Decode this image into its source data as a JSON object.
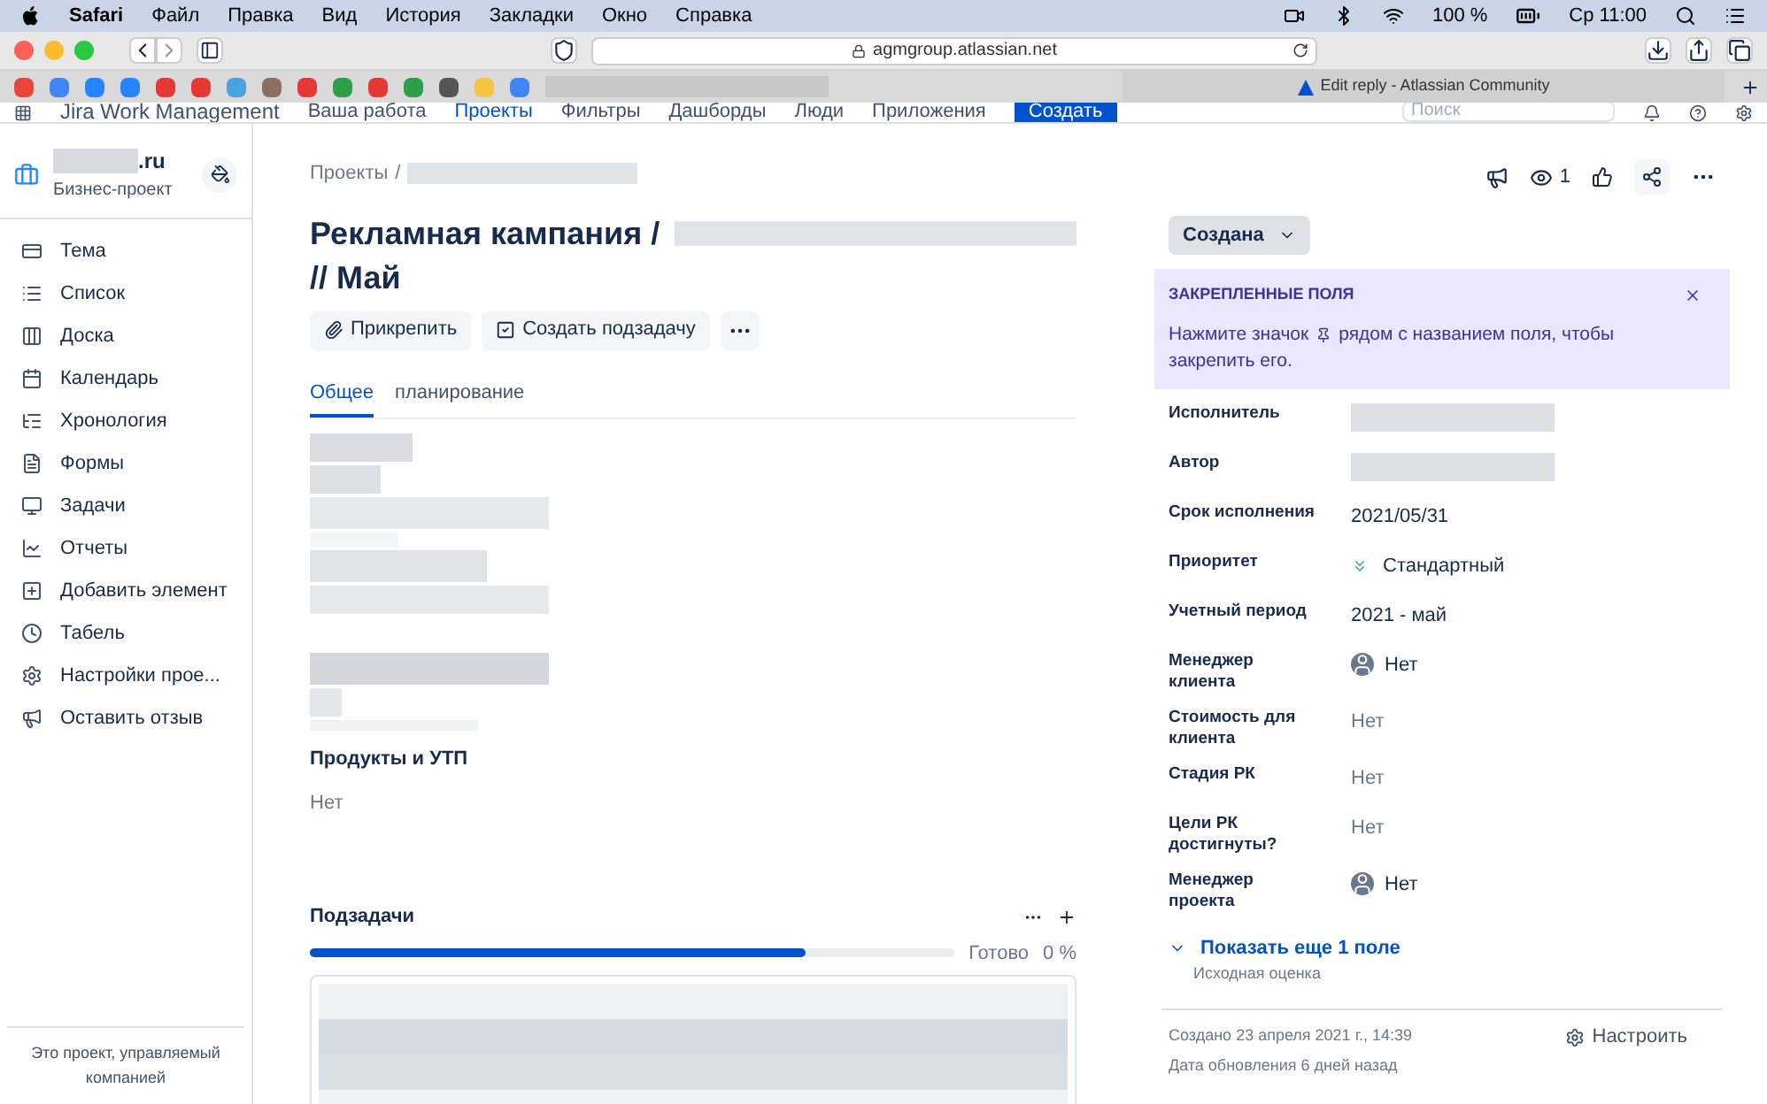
{
  "menubar": {
    "app": "Safari",
    "menus": [
      "Файл",
      "Правка",
      "Вид",
      "История",
      "Закладки",
      "Окно",
      "Справка"
    ],
    "battery": "100 %",
    "clock": "Ср 11:00"
  },
  "browser": {
    "url": "agmgroup.atlassian.net",
    "tab": "Edit reply - Atlassian Community"
  },
  "favicons": [
    {
      "color": "#e8453c"
    },
    {
      "color": "#4285f4"
    },
    {
      "color": "#2684ff"
    },
    {
      "color": "#2684ff"
    },
    {
      "color": "#e53935"
    },
    {
      "color": "#e53935"
    },
    {
      "color": "#4aa3df"
    },
    {
      "color": "#8d6e63"
    },
    {
      "color": "#e53935"
    },
    {
      "color": "#2e9e48"
    },
    {
      "color": "#e53935"
    },
    {
      "color": "#2e9e48"
    },
    {
      "color": "#555555"
    },
    {
      "color": "#f5c542"
    },
    {
      "color": "#4285f4"
    }
  ],
  "topnav": {
    "product": "Jira Work Management",
    "items": [
      {
        "label": "Ваша работа",
        "selected": false
      },
      {
        "label": "Проекты",
        "selected": true
      },
      {
        "label": "Фильтры",
        "selected": false
      },
      {
        "label": "Дашборды",
        "selected": false
      },
      {
        "label": "Люди",
        "selected": false
      },
      {
        "label": "Приложения",
        "selected": false
      }
    ],
    "create": "Создать",
    "search_placeholder": "Поиск"
  },
  "sidebar": {
    "project_name": ".ru",
    "project_type": "Бизнес-проект",
    "items": [
      {
        "label": "Тема",
        "kind": "topic"
      },
      {
        "label": "Список",
        "kind": "list"
      },
      {
        "label": "Доска",
        "kind": "board"
      },
      {
        "label": "Календарь",
        "kind": "calendar"
      },
      {
        "label": "Хронология",
        "kind": "timeline"
      },
      {
        "label": "Формы",
        "kind": "forms"
      },
      {
        "label": "Задачи",
        "kind": "tasks"
      },
      {
        "label": "Отчеты",
        "kind": "reports"
      },
      {
        "label": "Добавить элемент",
        "kind": "add"
      },
      {
        "label": "Табель",
        "kind": "clock"
      },
      {
        "label": "Настройки прое...",
        "kind": "settings"
      },
      {
        "label": "Оставить отзыв",
        "kind": "feedback"
      }
    ],
    "footer": "Это проект, управляемый компанией"
  },
  "issue": {
    "breadcrumb": "Проекты",
    "breadcrumb_sep": "/",
    "title_start": "Рекламная кампания /",
    "title_end": "// Май",
    "actions": [
      "Прикрепить",
      "Создать подзадачу"
    ],
    "tabs": [
      {
        "label": "Общее",
        "selected": true
      },
      {
        "label": "планирование",
        "selected": false
      }
    ],
    "field_label": "Продукты и УТП",
    "field_value": "Нет",
    "subtasks": {
      "title": "Подзадачи",
      "level": 0.77,
      "done_label": "Готово",
      "percent": "0 %"
    }
  },
  "panel": {
    "watchers": "1",
    "status": "Создана",
    "pinned": {
      "title": "ЗАКРЕПЛЕННЫЕ ПОЛЯ",
      "text_before": "Нажмите значок",
      "text_after": "рядом с названием поля, чтобы",
      "text_end": "закрепить его."
    },
    "fields": [
      {
        "label": "Исполнитель",
        "kind": "redacted"
      },
      {
        "label": "Автор",
        "kind": "redacted"
      },
      {
        "label": "Срок исполнения",
        "kind": "text",
        "value": "2021/05/31"
      },
      {
        "label": "Приоритет",
        "kind": "priority",
        "value": "Стандартный"
      },
      {
        "label": "Учетный период",
        "kind": "text",
        "value": "2021 - май"
      },
      {
        "label": "Менеджер клиента",
        "kind": "user",
        "value": "Нет"
      },
      {
        "label": "Стоимость для клиента",
        "kind": "empty",
        "value": "Нет"
      },
      {
        "label": "Стадия РК",
        "kind": "empty",
        "value": "Нет"
      },
      {
        "label": "Цели РК достигнуты?",
        "kind": "empty",
        "value": "Нет"
      },
      {
        "label": "Менеджер проекта",
        "kind": "user",
        "value": "Нет"
      }
    ],
    "show_more": "Показать еще 1 поле",
    "show_more_hint": "Исходная оценка",
    "created": "Создано 23 апреля 2021 г., 14:39",
    "updated": "Дата обновления 6 дней назад",
    "configure": "Настроить"
  }
}
